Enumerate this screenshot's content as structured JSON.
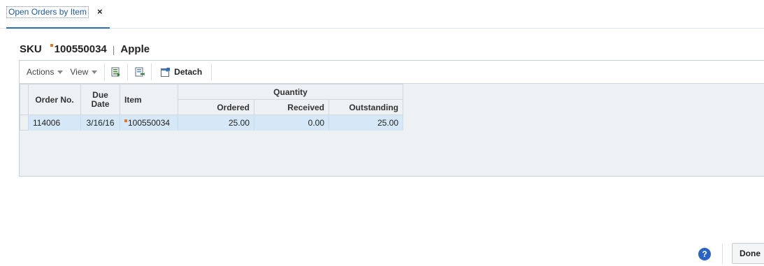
{
  "tab": {
    "label": "Open Orders by Item",
    "close": "×"
  },
  "header": {
    "sku_label": "SKU",
    "sku_value": "100550034",
    "separator": "|",
    "description": "Apple"
  },
  "toolbar": {
    "actions": "Actions",
    "view": "View",
    "detach": "Detach",
    "icons": [
      "export-excel-icon",
      "export-csv-icon",
      "detach-icon"
    ]
  },
  "table": {
    "columns": {
      "order_no": "Order No.",
      "due_date": "Due Date",
      "item": "Item",
      "quantity_group": "Quantity",
      "ordered": "Ordered",
      "received": "Received",
      "outstanding": "Outstanding"
    },
    "rows": [
      {
        "order_no": "114006",
        "due_date": "3/16/16",
        "item": "100550034",
        "ordered": "25.00",
        "received": "0.00",
        "outstanding": "25.00"
      }
    ]
  },
  "footer": {
    "help": "?",
    "done": "Done"
  },
  "colors": {
    "accent": "#2b6cb8",
    "required_mark": "#e8761b",
    "selected_row": "#d6e8f7",
    "help_icon": "#2b63c6"
  }
}
